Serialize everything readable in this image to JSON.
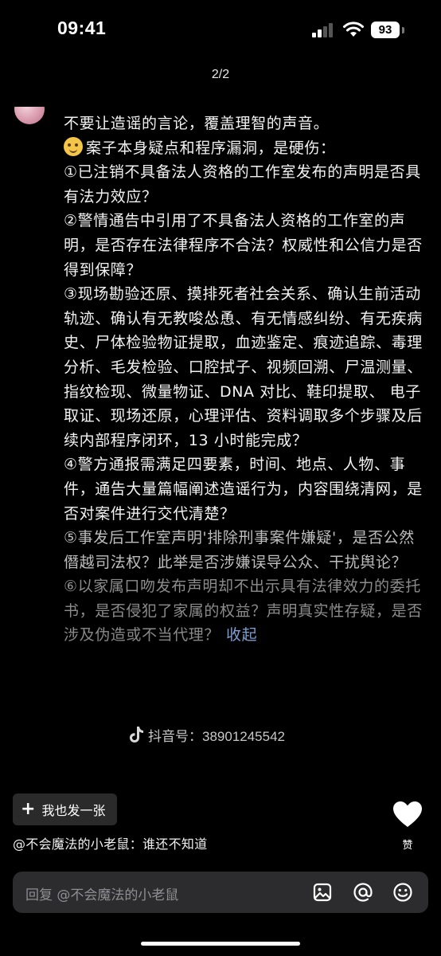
{
  "status_bar": {
    "time": "09:41",
    "battery": "93"
  },
  "header": {
    "page_indicator": "2/2"
  },
  "comment": {
    "lines": [
      "不要让造谣的言论，覆盖理智的声音。",
      "案子本身疑点和程序漏洞，是硬伤：",
      "①已注销不具备法人资格的工作室发布的声明是否具有法力效应？",
      "②警情通告中引用了不具备法人资格的工作室的声明，是否存在法律程序不合法？权威性和公信力是否得到保障？",
      "③现场勘验还原、摸排死者社会关系、确认生前活动轨迹、确认有无教唆怂恿、有无情感纠纷、有无疾病史、尸体检验物证提取，血迹鉴定、痕迹追踪、毒理分析、毛发检验、口腔拭子、视频回溯、尸温测量、指纹检现、微量物证、DNA 对比、鞋印提取、 电子取证、现场还原，心理评估、资料调取多个步骤及后续内部程序闭环，13 小时能完成？",
      "④警方通报需满足四要素，时间、地点、人物、事件，通告大量篇幅阐述造谣行为，内容围绕清网，是否对案件进行交代清楚？",
      "⑤事发后工作室声明'排除刑事案件嫌疑'，是否公然僭越司法权？此举是否涉嫌误导公众、干扰舆论？",
      "⑥以家属口吻发布声明却不出示具有法律效力的委托书，是否侵犯了家属的权益？声明真实性存疑，是否涉及伪造或不当代理？"
    ],
    "collapse_label": "收起"
  },
  "watermark": {
    "text": "抖音号：38901245542"
  },
  "actions": {
    "make_also_label": "我也发一张",
    "like_label": "赞"
  },
  "reply_to": {
    "text": "@不会魔法的小老鼠：谁还不知道"
  },
  "input": {
    "placeholder": "回复 @不会魔法的小老鼠"
  },
  "icons": {
    "back": "chevron-left-icon",
    "image": "image-icon",
    "mention": "at-icon",
    "emoji": "emoji-icon",
    "like": "heart-icon"
  }
}
